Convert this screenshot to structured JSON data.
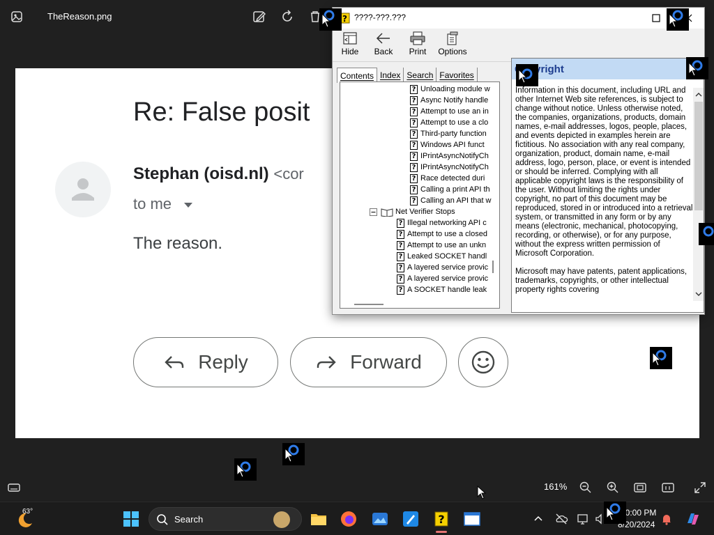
{
  "photos_app": {
    "file_name": "TheReason.png",
    "zoom": "161%"
  },
  "email": {
    "subject": "Re: False posit",
    "sender_name": "Stephan (oisd.nl)",
    "sender_email_partial": "<cor",
    "recipient": "to me",
    "body": "The reason.",
    "reply_label": "Reply",
    "forward_label": "Forward"
  },
  "help_window": {
    "title": "????-???.???",
    "toolbar": {
      "hide": "Hide",
      "back": "Back",
      "print": "Print",
      "options": "Options"
    },
    "tabs": [
      "Contents",
      "Index",
      "Search",
      "Favorites"
    ],
    "tree_items": [
      "Unloading module w",
      "Async Notify handle",
      "Attempt to use an in",
      "Attempt to use a clo",
      "Third-party function",
      "Windows API funct",
      "IPrintAsyncNotifyCh",
      "IPrintAsyncNotifyCh",
      "Race detected duri",
      "Calling a print API th",
      "Calling an API that w"
    ],
    "tree_book": "Net Verifier Stops",
    "tree_sub_items": [
      "Illegal networking API c",
      "Attempt to use a closed",
      "Attempt to use an unkn",
      "Leaked SOCKET handl",
      "A layered service provic",
      "A layered service provic",
      "A SOCKET handle leak"
    ],
    "content_heading": "Copyright",
    "content_paragraphs": [
      "Information in this document, including URL and other Internet Web site references, is subject to change without notice. Unless otherwise noted, the companies, organizations, products, domain names, e-mail addresses, logos, people, places, and events depicted in examples herein are fictitious. No association with any real company, organization, product, domain name, e-mail address, logo, person, place, or event is intended or should be inferred. Complying with all applicable copyright laws is the responsibility of the user. Without limiting the rights under copyright, no part of this document may be reproduced, stored in or introduced into a retrieval system, or transmitted in any form or by any means (electronic, mechanical, photocopying, recording, or otherwise), or for any purpose, without the express written permission of Microsoft Corporation.",
      "Microsoft may have patents, patent applications, trademarks, copyrights, or other intellectual property rights covering"
    ]
  },
  "taskbar": {
    "weather_temp": "63°",
    "search_placeholder": "Search",
    "time": "10:00 PM",
    "date": "8/20/2024"
  },
  "colors": {
    "accent_blue": "#0078d4",
    "help_heading_bg": "#c2daf4",
    "help_heading_text": "#1d3d8f",
    "active_indicator": "#e57373"
  }
}
